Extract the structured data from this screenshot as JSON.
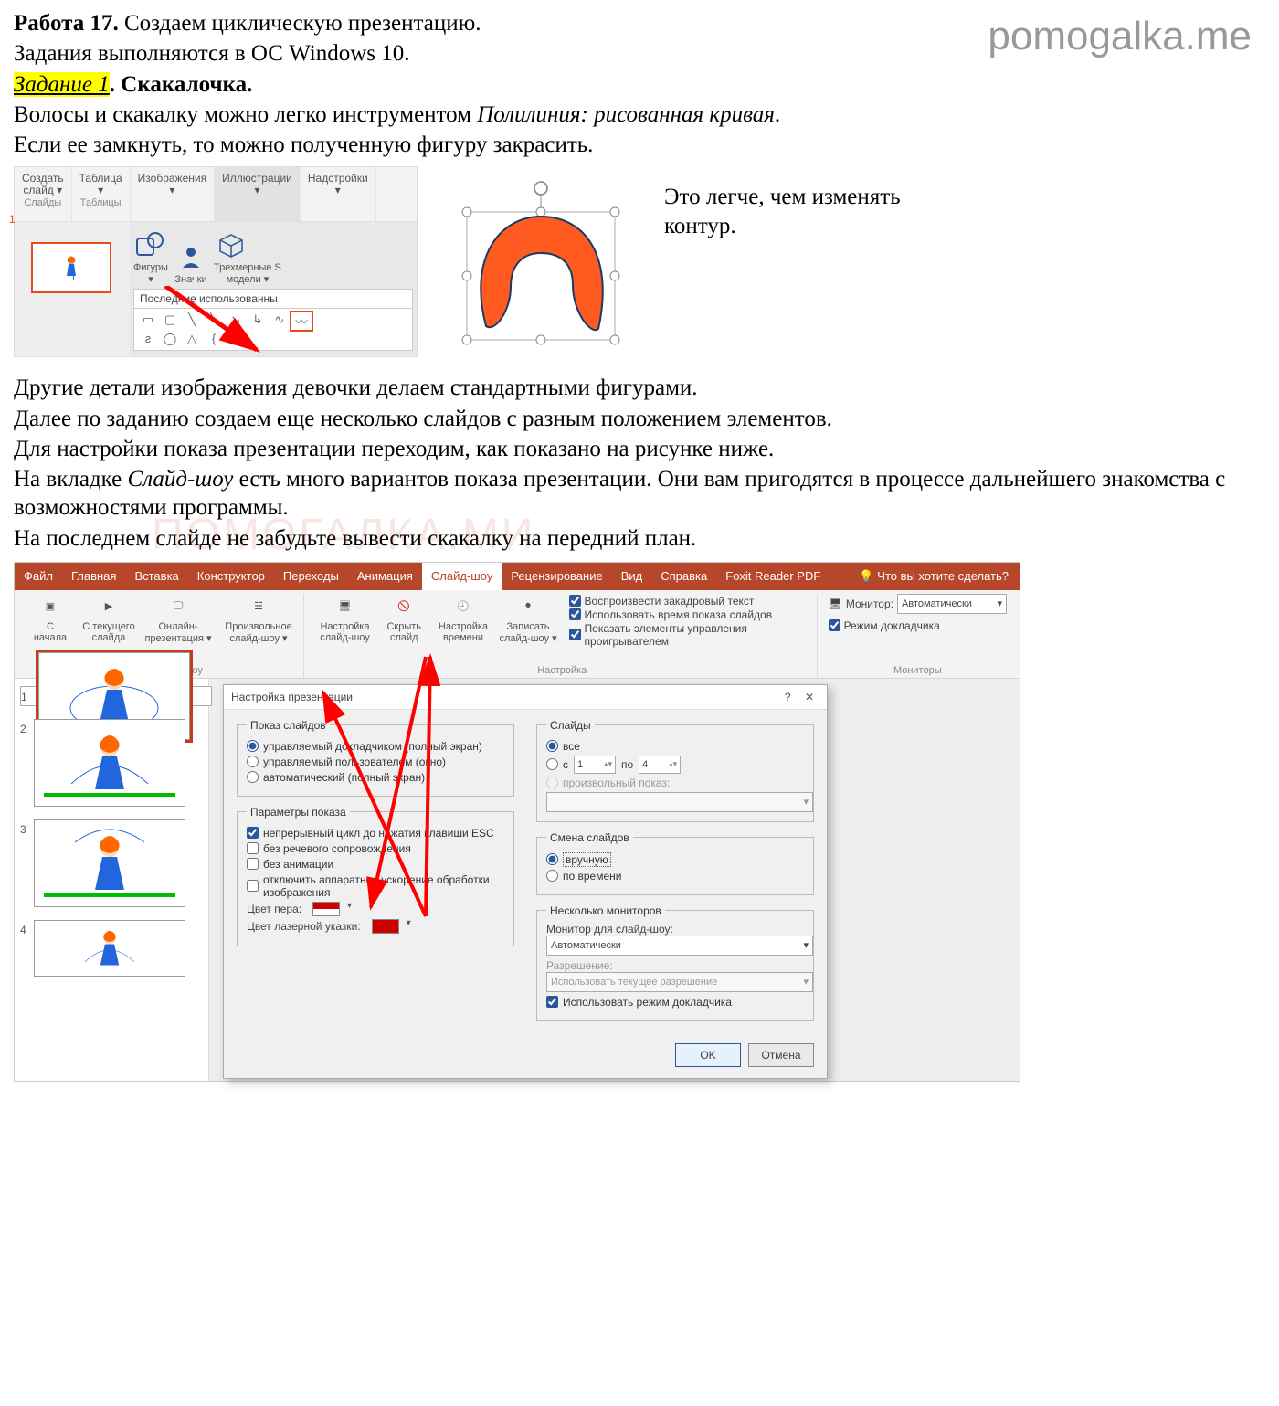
{
  "watermark": "pomogalka.me",
  "watermark2": "ПОМОГАЛКА.МИ",
  "header": {
    "work": "Работа 17.",
    "work_desc": " Создаем циклическую презентацию.",
    "os_line": "Задания выполняются в ОС Windows 10.",
    "task_label": "Задание 1",
    "task_title": ". Скакалочка."
  },
  "intro": {
    "line1a": "Волосы и скакалку можно легко инструментом ",
    "line1b": "Полилиния: рисованная кривая",
    "line1c": ".",
    "line2": "Если ее замкнуть, то можно полученную фигуру закрасить."
  },
  "ribbon1": {
    "tabs": [
      "Создать\nслайд ▾",
      "Таблица\n▾",
      "Изображения\n▾",
      "Иллюстрации\n▾",
      "Надстройки\n▾"
    ],
    "groups": [
      "Слайды",
      "Таблицы"
    ],
    "slide_num": "1",
    "illus": {
      "shapes_btn": "Фигуры\n▾",
      "icons_btn": "Значки",
      "models_btn": "Трехмерные S\nмодели ▾",
      "recent_label": "Последние использованны"
    }
  },
  "side_note": "Это легче, чем изменять контур.",
  "mid_paragraphs": [
    "Другие детали изображения девочки делаем стандартными фигурами.",
    "Далее по заданию создаем еще несколько слайдов с разным положением элементов.",
    "Для настройки показа презентации переходим, как показано на рисунке ниже."
  ],
  "mid_line4a": "На вкладке ",
  "mid_line4b": "Слайд-шоу",
  "mid_line4c": " есть много вариантов показа презентации. Они вам пригодятся в процессе дальнейшего знакомства с возможностями программы.",
  "mid_line5": "На последнем слайде не забудьте вывести скакалку на передний план.",
  "pp": {
    "tabs": [
      "Файл",
      "Главная",
      "Вставка",
      "Конструктор",
      "Переходы",
      "Анимация",
      "Слайд-шоу",
      "Рецензирование",
      "Вид",
      "Справка",
      "Foxit Reader PDF"
    ],
    "tell_me": "Что вы хотите сделать?",
    "groups": {
      "start": {
        "btns": [
          "С\nначала",
          "С текущего\nслайда",
          "Онлайн-\nпрезентация ▾",
          "Произвольное\nслайд-шоу ▾"
        ],
        "label": "Начать слайд-шоу"
      },
      "setup": {
        "btns": [
          "Настройка\nслайд-шоу",
          "Скрыть\nслайд",
          "Настройка\nвремени",
          "Записать\nслайд-шоу ▾"
        ],
        "checks": [
          "Воспроизвести закадровый текст",
          "Использовать время показа слайдов",
          "Показать элементы управления проигрывателем"
        ],
        "label": "Настройка"
      },
      "monitors": {
        "monitor_label": "Монитор:",
        "monitor_value": "Автоматически",
        "presenter": "Режим докладчика",
        "label": "Мониторы"
      }
    },
    "thumbs": [
      "1",
      "2",
      "3",
      "4"
    ]
  },
  "dialog": {
    "title": "Настройка презентации",
    "show_type": {
      "legend": "Показ слайдов",
      "opt1": "управляемый докладчиком (полный экран)",
      "opt2": "управляемый пользователем (окно)",
      "opt3": "автоматический (полный экран)"
    },
    "show_opts": {
      "legend": "Параметры показа",
      "c1": "непрерывный цикл до нажатия клавиши ESC",
      "c2": "без речевого сопровождения",
      "c3": "без анимации",
      "c4": "отключить аппаратное ускорение обработки изображения",
      "pen_label": "Цвет пера:",
      "laser_label": "Цвет лазерной указки:"
    },
    "slides": {
      "legend": "Слайды",
      "all": "все",
      "from": "с",
      "to": "по",
      "from_val": "1",
      "to_val": "4",
      "custom": "произвольный показ:"
    },
    "advance": {
      "legend": "Смена слайдов",
      "manual": "вручную",
      "timed": "по времени"
    },
    "monitors": {
      "legend": "Несколько мониторов",
      "mon_label": "Монитор для слайд-шоу:",
      "mon_value": "Автоматически",
      "res_label": "Разрешение:",
      "res_value": "Использовать текущее разрешение",
      "presenter": "Использовать режим докладчика"
    },
    "ok": "OK",
    "cancel": "Отмена"
  }
}
